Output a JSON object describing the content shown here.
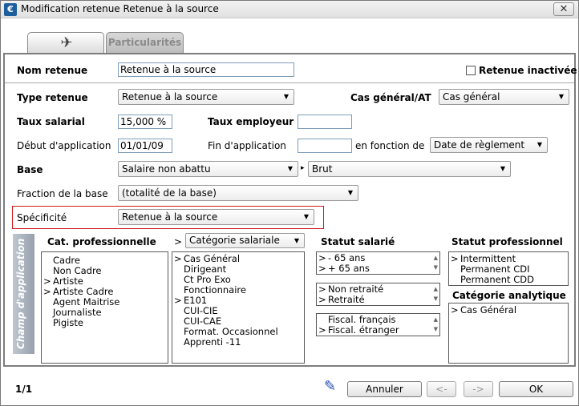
{
  "window": {
    "title": "Modification retenue Retenue à la source",
    "close_glyph": "✕",
    "app_icon_letter": "€"
  },
  "tabs": [
    {
      "icon": "wrench-icon",
      "glyph": "✈"
    },
    {
      "label": "Particularités"
    }
  ],
  "form": {
    "nom_retenue_label": "Nom retenue",
    "nom_retenue_value": "Retenue à la source",
    "retenue_inactivee_label": "Retenue inactivée",
    "type_retenue_label": "Type retenue",
    "type_retenue_value": "Retenue à la source",
    "cas_general_label": "Cas général/AT",
    "cas_general_value": "Cas général",
    "taux_salarial_label": "Taux salarial",
    "taux_salarial_value": "15,000 %",
    "taux_employeur_label": "Taux employeur",
    "taux_employeur_value": "",
    "debut_label": "Début d'application",
    "debut_value": "01/01/09",
    "fin_label": "Fin d'application",
    "fin_value": "",
    "en_fonction_label": "en fonction de",
    "en_fonction_value": "Date de règlement",
    "base_label": "Base",
    "base_value": "Salaire non abattu",
    "base_sep": "▸",
    "base_value2": "Brut",
    "fraction_label": "Fraction de la base",
    "fraction_value": "(totalité de la base)",
    "specificite_label": "Spécificité",
    "specificite_value": "Retenue à la source"
  },
  "champ": {
    "band_label": "Champ d'application",
    "cat_pro_header": "Cat. professionnelle",
    "cat_pro_items": [
      {
        "mark": "",
        "label": "Cadre"
      },
      {
        "mark": "",
        "label": "Non Cadre"
      },
      {
        "mark": ">",
        "label": "Artiste"
      },
      {
        "mark": ">",
        "label": "Artiste Cadre"
      },
      {
        "mark": "",
        "label": "Agent Maitrise"
      },
      {
        "mark": "",
        "label": "Journaliste"
      },
      {
        "mark": "",
        "label": "Pigiste"
      }
    ],
    "cat_sal_marker": ">",
    "cat_sal_select": "Catégorie salariale",
    "cat_sal_items": [
      {
        "mark": ">",
        "label": "Cas Général"
      },
      {
        "mark": "",
        "label": "Dirigeant"
      },
      {
        "mark": "",
        "label": "Ct Pro Exo"
      },
      {
        "mark": "",
        "label": "Fonctionnaire"
      },
      {
        "mark": ">",
        "label": "E101"
      },
      {
        "mark": "",
        "label": "CUI-CIE"
      },
      {
        "mark": "",
        "label": "CUI-CAE"
      },
      {
        "mark": "",
        "label": "Format. Occasionnel"
      },
      {
        "mark": "",
        "label": "Apprenti -11"
      }
    ],
    "statut_sal_header": "Statut salarié",
    "statut_sal_group1": [
      {
        "mark": ">",
        "label": " - 65 ans"
      },
      {
        "mark": ">",
        "label": " + 65 ans"
      }
    ],
    "statut_sal_group2": [
      {
        "mark": ">",
        "label": "Non retraité"
      },
      {
        "mark": ">",
        "label": "Retraité"
      }
    ],
    "statut_sal_group3": [
      {
        "mark": "",
        "label": "Fiscal. français"
      },
      {
        "mark": ">",
        "label": "Fiscal. étranger"
      }
    ],
    "statut_pro_header": "Statut professionnel",
    "statut_pro_items": [
      {
        "mark": ">",
        "label": "Intermittent"
      },
      {
        "mark": "",
        "label": "Permanent CDI"
      },
      {
        "mark": "",
        "label": "Permanent CDD"
      }
    ],
    "cat_analytique_header": "Catégorie analytique",
    "cat_analytique_items": [
      {
        "mark": ">",
        "label": "Cas Général"
      }
    ]
  },
  "footer": {
    "page_counter": "1/1",
    "annuler_label": "Annuler",
    "prev_label": "<-",
    "next_label": "->",
    "ok_label": "OK"
  }
}
